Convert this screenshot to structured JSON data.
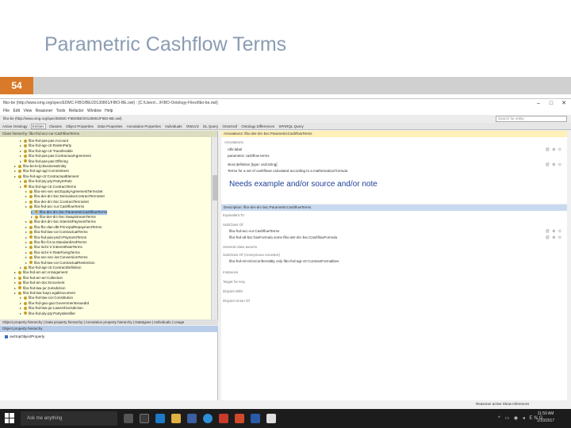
{
  "slide": {
    "title": "Parametric Cashflow Terms",
    "number": "54"
  },
  "window": {
    "title": "fibo-be (http://www.omg.org/spec/EDMC-FIBO/BE/20130801/FIBO-BE.owl) : [C:\\Users\\...\\FIBO-Ontology-Files\\fibo-be.owl]",
    "menu": [
      "File",
      "Edit",
      "View",
      "Reasoner",
      "Tools",
      "Refactor",
      "Window",
      "Help"
    ],
    "address": "fibo-be (http://www.omg.org/spec/EDMC-FIBO/BE/20130801/FIBO-BE.owl)",
    "search_placeholder": "Search for entity"
  },
  "tabs": [
    "Active Ontology",
    "Entities",
    "Classes",
    "Object Properties",
    "Data Properties",
    "Annotation Properties",
    "Individuals",
    "OWLViz",
    "DL Query",
    "OntoGraf",
    "Ontology Differences",
    "SPARQL Query"
  ],
  "active_tab": "Entities",
  "class_hierarchy": {
    "header": "Class hierarchy: fibo-fnd-acc-cur-CashflowTerms",
    "rows": [
      {
        "label": "fibo-fnd-pas-pas:Account",
        "indent": 3,
        "sel": false
      },
      {
        "label": "fibo-fnd-agr-ctr:RoleInParty",
        "indent": 3,
        "sel": false
      },
      {
        "label": "fibo-fnd-agr-ctr:Transferable",
        "indent": 3,
        "sel": false
      },
      {
        "label": "fibo-fnd-pas-pas:ContractualAgreement",
        "indent": 3,
        "sel": false
      },
      {
        "label": "fibo-fnd-pas-pas:Offering",
        "indent": 3,
        "sel": false
      },
      {
        "label": "fibo-be-le-lp:BusinessEntity",
        "indent": 2,
        "sel": false
      },
      {
        "label": "fibo-fnd-agr-agr:Commitment",
        "indent": 2,
        "sel": false
      },
      {
        "label": "fibo-fnd-agr-ctr:ContractualElement",
        "indent": 2,
        "sel": false
      },
      {
        "label": "fibo-fnd-pty-pty:PartyInRole",
        "indent": 3,
        "sel": false
      },
      {
        "label": "fibo-fnd-agr-ctr:ContractTerms",
        "indent": 3,
        "sel": false
      },
      {
        "label": "fibo-sec-sec-ast:EquityAgreementTermsSet",
        "indent": 4,
        "sel": false
      },
      {
        "label": "fibo-der-drc-bsc:DerivativeContractTermsSet",
        "indent": 4,
        "sel": false
      },
      {
        "label": "fibo-der-drc-bsc:ContractTermsSet",
        "indent": 4,
        "sel": false
      },
      {
        "label": "fibo-fnd-acc-cur:CashflowTerms",
        "indent": 4,
        "sel": false
      },
      {
        "label": "fibo-der-drc-bsc:ParametricCashflowTerms",
        "indent": 5,
        "sel": true
      },
      {
        "label": "fibo-der-drc-bsc:SwapStreamTerms",
        "indent": 5,
        "sel": false
      },
      {
        "label": "fibo-der-drc-bsc:InterestPaymentTerms",
        "indent": 4,
        "sel": false
      },
      {
        "label": "fibo-fbc-dae-dbt:PrincipalRepaymentTerms",
        "indent": 4,
        "sel": false
      },
      {
        "label": "fibo-fnd-law-cor:ContractualTerms",
        "indent": 4,
        "sel": false
      },
      {
        "label": "fibo-fnd-pas-psch:PaymentTerms",
        "indent": 4,
        "sel": false
      },
      {
        "label": "fibo-fbc-fct-ra:StandardizedTerms",
        "indent": 4,
        "sel": false
      },
      {
        "label": "fibo-ind-ir-ir:InterestRateTerms",
        "indent": 4,
        "sel": false
      },
      {
        "label": "fibo-ind-ir-ir:RateFixingTerms",
        "indent": 4,
        "sel": false
      },
      {
        "label": "fibo-sec-sec-iss:ConversionTerms",
        "indent": 4,
        "sel": false
      },
      {
        "label": "fibo-fnd-law-cor:ContractualRestriction",
        "indent": 4,
        "sel": false
      },
      {
        "label": "fibo-fnd-agr-ctr:ContractDefinition",
        "indent": 3,
        "sel": false
      },
      {
        "label": "fibo-fnd-arr-arr:Arrangement",
        "indent": 2,
        "sel": false
      },
      {
        "label": "fibo-fnd-arr-arr:Collection",
        "indent": 2,
        "sel": false
      },
      {
        "label": "fibo-fnd-arr-doc:Document",
        "indent": 2,
        "sel": false
      },
      {
        "label": "fibo-fnd-law-jur:Jurisdiction",
        "indent": 2,
        "sel": false
      },
      {
        "label": "fibo-fnd-law-lcap:LegalDocument",
        "indent": 2,
        "sel": false
      },
      {
        "label": "fibo-fnd-law-cor:Constitution",
        "indent": 3,
        "sel": false
      },
      {
        "label": "fibo-fnd-gao-gao:GovernmentIssuedId",
        "indent": 3,
        "sel": false
      },
      {
        "label": "fibo-fnd-law-jur:LawsOfJurisdiction",
        "indent": 3,
        "sel": false
      },
      {
        "label": "fibo-fnd-pty-pty:PartyIdentifier",
        "indent": 3,
        "sel": false
      }
    ]
  },
  "lower_left": {
    "tabs": "Object property hierarchy | Data property hierarchy | Annotation property hierarchy | Datatypes | Individuals | Usage",
    "title": "Object property hierarchy",
    "item": "owl:topObjectProperty"
  },
  "right": {
    "annotations_title": "Annotations: fibo-der-drc-bsc:ParametricCashflowTerms",
    "annotations_label": "Annotations",
    "annotations": [
      "rdfs:label",
      "parametric cashflow terms",
      "skos:definition  [type: xsd:string]",
      "Terms for a set of cashflows calculated according to a mathematical formula"
    ],
    "note": "Needs example and/or source and/or note",
    "description_title": "Description: fibo-der-drc-bsc:ParametricCashflowTerms",
    "sections": {
      "equivalent": "Equivalent To",
      "subclass": "SubClass Of",
      "general": "General class axioms",
      "subclass_anon": "SubClass Of (Anonymous Ancestor)",
      "instances": "Instances",
      "target_keys": "Target for Key",
      "disjoint": "Disjoint With",
      "disjoint_union": "Disjoint Union Of"
    },
    "subclass_items": [
      "fibo-fnd-acc-cur:CashflowTerms",
      "fibo-fnd-utl-bsc:hasFormula some fibo-der-drc-bsc:CashflowFormula"
    ],
    "anon_items": [
      "fibo-fnd-rel-rel:isConferredBy only fibo-fnd-agr-ctr:ContractFormalities"
    ],
    "reasoner_status": "Reasoner active   Show Inferences"
  },
  "taskbar": {
    "search_text": "Ask me anything",
    "time": "11:59 AM",
    "date": "1/10/2017",
    "tray": "^ ▭ ◉ ◂ ENG"
  },
  "colors": {
    "accent_orange": "#d97a2a",
    "title_blue_gray": "#8a9cb3",
    "note_blue": "#1f3f99",
    "tree_bg": "#ffffe2",
    "selection": "#9ec3e6"
  }
}
